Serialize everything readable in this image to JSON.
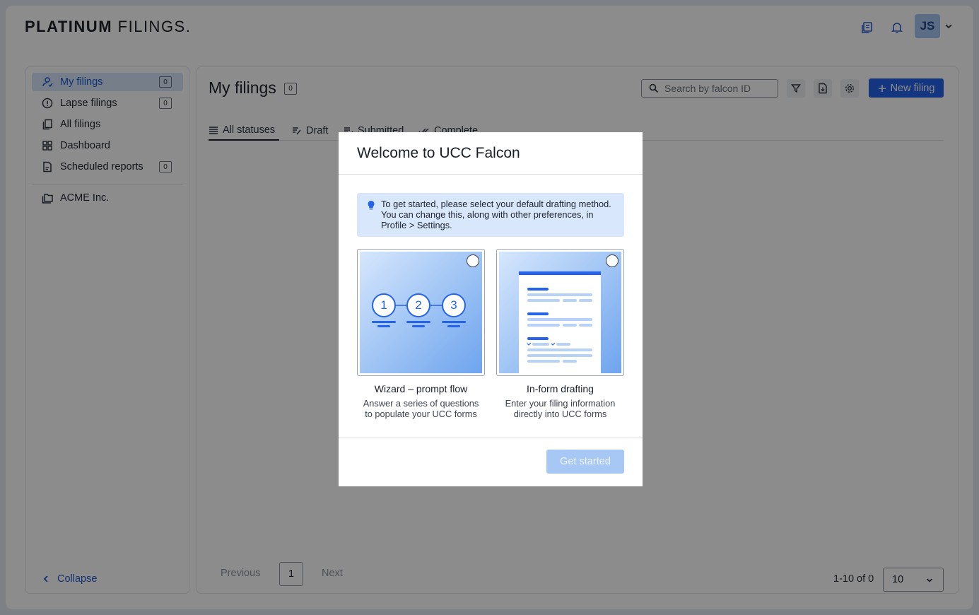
{
  "header": {
    "logo_bold": "PLATINUM",
    "logo_thin": "FILINGS.",
    "avatar_initials": "JS"
  },
  "sidebar": {
    "items": [
      {
        "label": "My filings",
        "count": "0",
        "icon": "user-icon",
        "active": true
      },
      {
        "label": "Lapse filings",
        "count": "0",
        "icon": "alert-circle-icon"
      },
      {
        "label": "All filings",
        "icon": "documents-icon"
      },
      {
        "label": "Dashboard",
        "icon": "dashboard-icon"
      },
      {
        "label": "Scheduled reports",
        "count": "0",
        "icon": "report-icon"
      }
    ],
    "org": {
      "label": "ACME Inc.",
      "icon": "folder-icon"
    },
    "collapse_label": "Collapse"
  },
  "main": {
    "title": "My filings",
    "title_count": "0",
    "search_placeholder": "Search by falcon ID",
    "new_filing_label": "New filing",
    "tabs": [
      {
        "label": "All statuses",
        "icon": "list-icon",
        "active": true
      },
      {
        "label": "Draft",
        "icon": "draft-icon"
      },
      {
        "label": "Submitted",
        "icon": "submitted-icon"
      },
      {
        "label": "Complete",
        "icon": "double-check-icon"
      }
    ],
    "pagination": {
      "previous": "Previous",
      "page": "1",
      "next": "Next",
      "range": "1-10 of 0",
      "page_size": "10"
    }
  },
  "modal": {
    "title": "Welcome to UCC Falcon",
    "info": "To get started, please select your default drafting method. You can change this, along with other preferences, in Profile > Settings.",
    "options": [
      {
        "title": "Wizard – prompt flow",
        "desc_line1": "Answer a series of questions",
        "desc_line2": "to populate your UCC forms",
        "steps": [
          "1",
          "2",
          "3"
        ]
      },
      {
        "title": "In-form drafting",
        "desc_line1": "Enter your filing information",
        "desc_line2": "directly into UCC forms"
      }
    ],
    "get_started_label": "Get started"
  },
  "colors": {
    "accent": "#2563eb",
    "active_bg": "#d6e6fa",
    "info_bg": "#d8e7fb",
    "disabled_button": "#a7c8f5"
  }
}
